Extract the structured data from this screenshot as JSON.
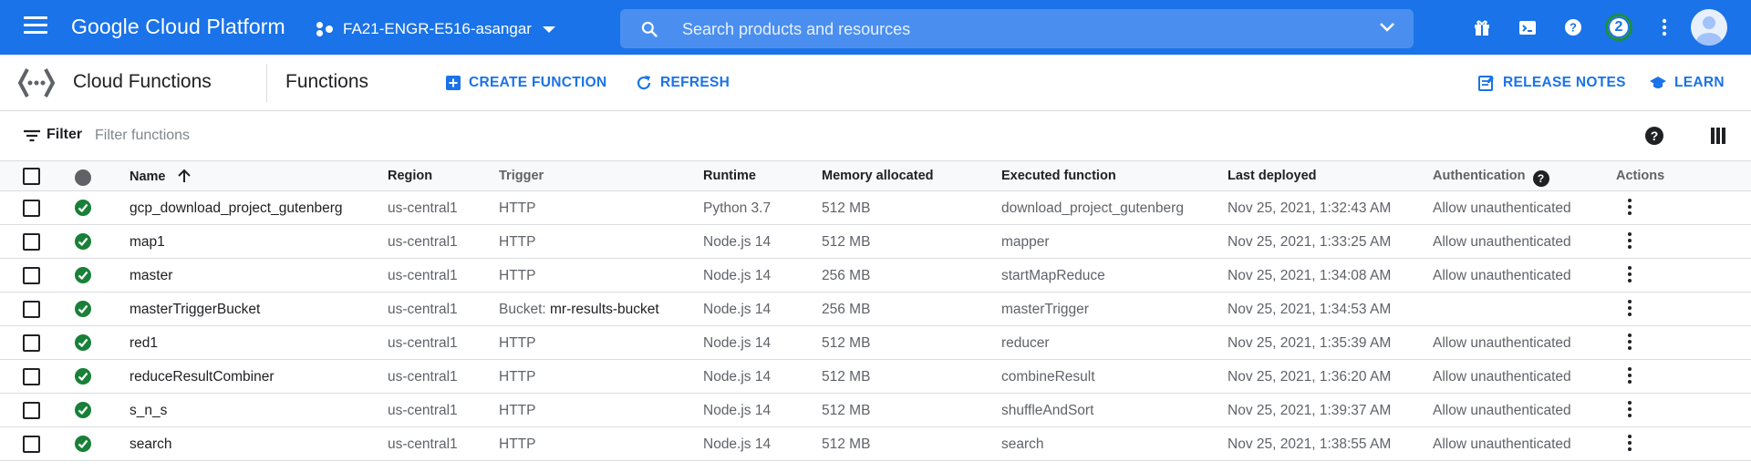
{
  "topbar": {
    "brand": "Google Cloud Platform",
    "project": "FA21-ENGR-E516-asangar",
    "search_placeholder": "Search products and resources",
    "notification_count": "2",
    "icons": [
      "menu-icon",
      "gift-icon",
      "terminal-icon",
      "help-icon",
      "more-vert-icon",
      "account-icon"
    ]
  },
  "subheader": {
    "product": "Cloud Functions",
    "page_title": "Functions",
    "create_label": "CREATE FUNCTION",
    "refresh_label": "REFRESH",
    "release_notes_label": "RELEASE NOTES",
    "learn_label": "LEARN"
  },
  "filter": {
    "label": "Filter",
    "placeholder": "Filter functions"
  },
  "table": {
    "columns": {
      "name": "Name",
      "region": "Region",
      "trigger": "Trigger",
      "runtime": "Runtime",
      "memory": "Memory allocated",
      "executed": "Executed function",
      "deployed": "Last deployed",
      "auth": "Authentication",
      "actions": "Actions"
    },
    "rows": [
      {
        "name": "gcp_download_project_gutenberg",
        "region": "us-central1",
        "trigger": "HTTP",
        "trigger_value": "",
        "runtime": "Python 3.7",
        "memory": "512 MB",
        "executed": "download_project_gutenberg",
        "deployed": "Nov 25, 2021, 1:32:43 AM",
        "auth": "Allow unauthenticated"
      },
      {
        "name": "map1",
        "region": "us-central1",
        "trigger": "HTTP",
        "trigger_value": "",
        "runtime": "Node.js 14",
        "memory": "512 MB",
        "executed": "mapper",
        "deployed": "Nov 25, 2021, 1:33:25 AM",
        "auth": "Allow unauthenticated"
      },
      {
        "name": "master",
        "region": "us-central1",
        "trigger": "HTTP",
        "trigger_value": "",
        "runtime": "Node.js 14",
        "memory": "256 MB",
        "executed": "startMapReduce",
        "deployed": "Nov 25, 2021, 1:34:08 AM",
        "auth": "Allow unauthenticated"
      },
      {
        "name": "masterTriggerBucket",
        "region": "us-central1",
        "trigger": "Bucket: ",
        "trigger_value": "mr-results-bucket",
        "runtime": "Node.js 14",
        "memory": "256 MB",
        "executed": "masterTrigger",
        "deployed": "Nov 25, 2021, 1:34:53 AM",
        "auth": ""
      },
      {
        "name": "red1",
        "region": "us-central1",
        "trigger": "HTTP",
        "trigger_value": "",
        "runtime": "Node.js 14",
        "memory": "512 MB",
        "executed": "reducer",
        "deployed": "Nov 25, 2021, 1:35:39 AM",
        "auth": "Allow unauthenticated"
      },
      {
        "name": "reduceResultCombiner",
        "region": "us-central1",
        "trigger": "HTTP",
        "trigger_value": "",
        "runtime": "Node.js 14",
        "memory": "512 MB",
        "executed": "combineResult",
        "deployed": "Nov 25, 2021, 1:36:20 AM",
        "auth": "Allow unauthenticated"
      },
      {
        "name": "s_n_s",
        "region": "us-central1",
        "trigger": "HTTP",
        "trigger_value": "",
        "runtime": "Node.js 14",
        "memory": "512 MB",
        "executed": "shuffleAndSort",
        "deployed": "Nov 25, 2021, 1:39:37 AM",
        "auth": "Allow unauthenticated"
      },
      {
        "name": "search",
        "region": "us-central1",
        "trigger": "HTTP",
        "trigger_value": "",
        "runtime": "Node.js 14",
        "memory": "512 MB",
        "executed": "search",
        "deployed": "Nov 25, 2021, 1:38:55 AM",
        "auth": "Allow unauthenticated"
      }
    ]
  },
  "colors": {
    "topbar": "#1a73e8",
    "accent": "#1a73e8",
    "status_ok": "#188038"
  }
}
